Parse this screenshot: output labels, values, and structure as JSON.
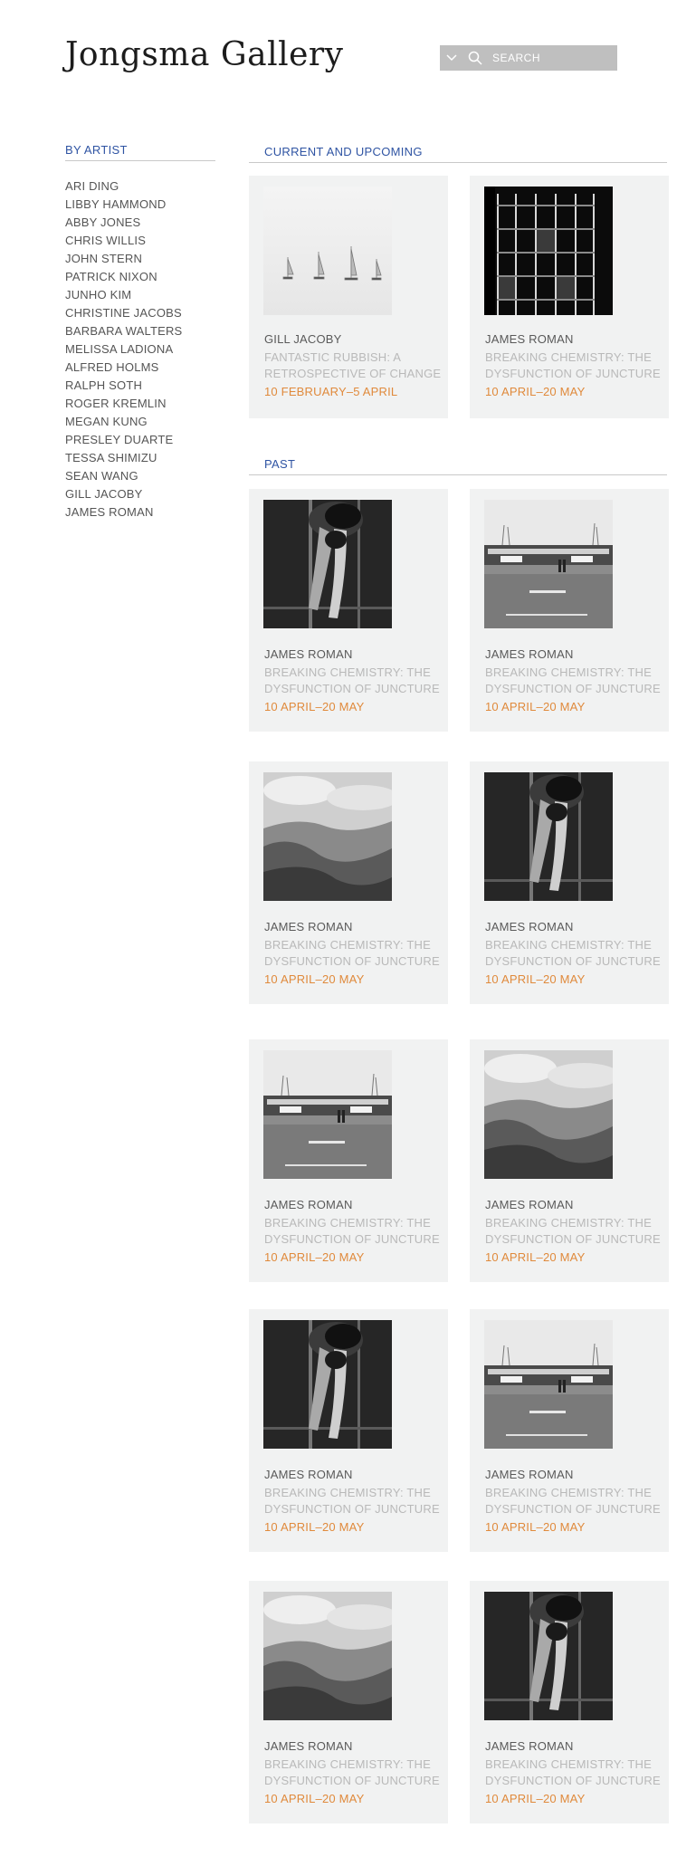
{
  "header": {
    "logo": "Jongsma Gallery",
    "search_placeholder": "SEARCH"
  },
  "sidebar": {
    "heading": "BY ARTIST",
    "artists": [
      "ARI DING",
      "LIBBY HAMMOND",
      "ABBY JONES",
      "CHRIS WILLIS",
      "JOHN STERN",
      "PATRICK NIXON",
      "JUNHO KIM",
      "CHRISTINE JACOBS",
      "BARBARA WALTERS",
      "MELISSA LADIONA",
      "ALFRED HOLMS",
      "RALPH SOTH",
      "ROGER KREMLIN",
      "MEGAN KUNG",
      "PRESLEY DUARTE",
      "TESSA SHIMIZU",
      "SEAN WANG",
      "GILL JACOBY",
      "JAMES ROMAN"
    ]
  },
  "sections": {
    "current": {
      "heading": "CURRENT AND UPCOMING",
      "cards": [
        {
          "artist": "GILL JACOBY",
          "title": "FANTASTIC RUBBISH: A RETROSPECTIVE OF CHANGE",
          "dates": "10 FEBRUARY–5 APRIL",
          "image": "sailboats"
        },
        {
          "artist": "JAMES ROMAN",
          "title": "BREAKING CHEMISTRY: THE DYSFUNCTION OF JUNCTURE",
          "dates": "10 APRIL–20 MAY",
          "image": "building"
        }
      ]
    },
    "past": {
      "heading": "PAST",
      "cards": [
        {
          "artist": "JAMES ROMAN",
          "title": "BREAKING CHEMISTRY: THE DYSFUNCTION OF JUNCTURE",
          "dates": "10 APRIL–20 MAY",
          "image": "dancer"
        },
        {
          "artist": "JAMES ROMAN",
          "title": "BREAKING CHEMISTRY: THE DYSFUNCTION OF JUNCTURE",
          "dates": "10 APRIL–20 MAY",
          "image": "diner"
        },
        {
          "artist": "JAMES ROMAN",
          "title": "BREAKING CHEMISTRY: THE DYSFUNCTION OF JUNCTURE",
          "dates": "10 APRIL–20 MAY",
          "image": "valley"
        },
        {
          "artist": "JAMES ROMAN",
          "title": "BREAKING CHEMISTRY: THE DYSFUNCTION OF JUNCTURE",
          "dates": "10 APRIL–20 MAY",
          "image": "dancer"
        },
        {
          "artist": "JAMES ROMAN",
          "title": "BREAKING CHEMISTRY: THE DYSFUNCTION OF JUNCTURE",
          "dates": "10 APRIL–20 MAY",
          "image": "diner"
        },
        {
          "artist": "JAMES ROMAN",
          "title": "BREAKING CHEMISTRY: THE DYSFUNCTION OF JUNCTURE",
          "dates": "10 APRIL–20 MAY",
          "image": "valley"
        },
        {
          "artist": "JAMES ROMAN",
          "title": "BREAKING CHEMISTRY: THE DYSFUNCTION OF JUNCTURE",
          "dates": "10 APRIL–20 MAY",
          "image": "dancer"
        },
        {
          "artist": "JAMES ROMAN",
          "title": "BREAKING CHEMISTRY: THE DYSFUNCTION OF JUNCTURE",
          "dates": "10 APRIL–20 MAY",
          "image": "diner"
        },
        {
          "artist": "JAMES ROMAN",
          "title": "BREAKING CHEMISTRY: THE DYSFUNCTION OF JUNCTURE",
          "dates": "10 APRIL–20 MAY",
          "image": "valley"
        },
        {
          "artist": "JAMES ROMAN",
          "title": "BREAKING CHEMISTRY: THE DYSFUNCTION OF JUNCTURE",
          "dates": "10 APRIL–20 MAY",
          "image": "dancer"
        }
      ]
    }
  },
  "colors": {
    "accent": "#2f54a3",
    "date": "#e08a3c",
    "card_bg": "#f1f2f2"
  }
}
